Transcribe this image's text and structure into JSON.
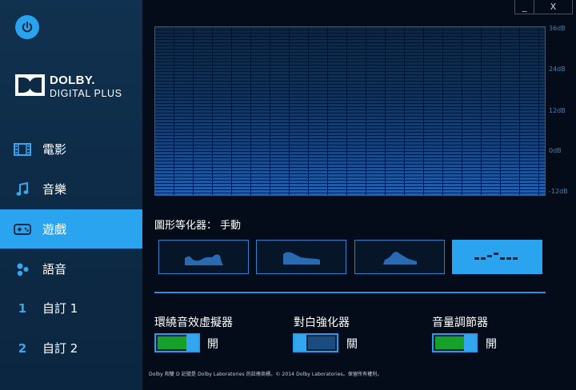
{
  "window": {
    "minimize_label": "_",
    "close_label": "X"
  },
  "sidebar": {
    "logo": {
      "line1": "DOLBY.",
      "line2": "DIGITAL PLUS"
    },
    "items": [
      {
        "label": "電影",
        "icon": "film-icon",
        "active": false
      },
      {
        "label": "音樂",
        "icon": "music-note-icon",
        "active": false
      },
      {
        "label": "遊戲",
        "icon": "gamepad-icon",
        "active": true
      },
      {
        "label": "語音",
        "icon": "voice-people-icon",
        "active": false
      },
      {
        "label": "自訂 1",
        "icon": "number-1",
        "icon_text": "1",
        "active": false
      },
      {
        "label": "自訂 2",
        "icon": "number-2",
        "icon_text": "2",
        "active": false
      }
    ]
  },
  "eq": {
    "db_labels": [
      "36dB",
      "24dB",
      "12dB",
      "0dB",
      "-12dB"
    ],
    "title": "圖形等化器：",
    "mode": "手動",
    "presets": [
      {
        "name": "open-preset",
        "active": false
      },
      {
        "name": "rich-preset",
        "active": false
      },
      {
        "name": "focused-preset",
        "active": false
      },
      {
        "name": "manual-preset",
        "active": true
      }
    ]
  },
  "controls": [
    {
      "label": "環繞音效虛擬器",
      "state": "開",
      "on": true
    },
    {
      "label": "對白強化器",
      "state": "關",
      "on": false
    },
    {
      "label": "音量調節器",
      "state": "開",
      "on": true
    }
  ],
  "footer": "Dolby 和雙 D 記號是 Dolby Laboratories 的註冊商標。© 2014 Dolby Laboratories。保留所有權利。",
  "colors": {
    "accent": "#2ba4ef",
    "toggle_on": "#18a02c",
    "background": "#030c18",
    "sidebar": "#0d2a45"
  }
}
